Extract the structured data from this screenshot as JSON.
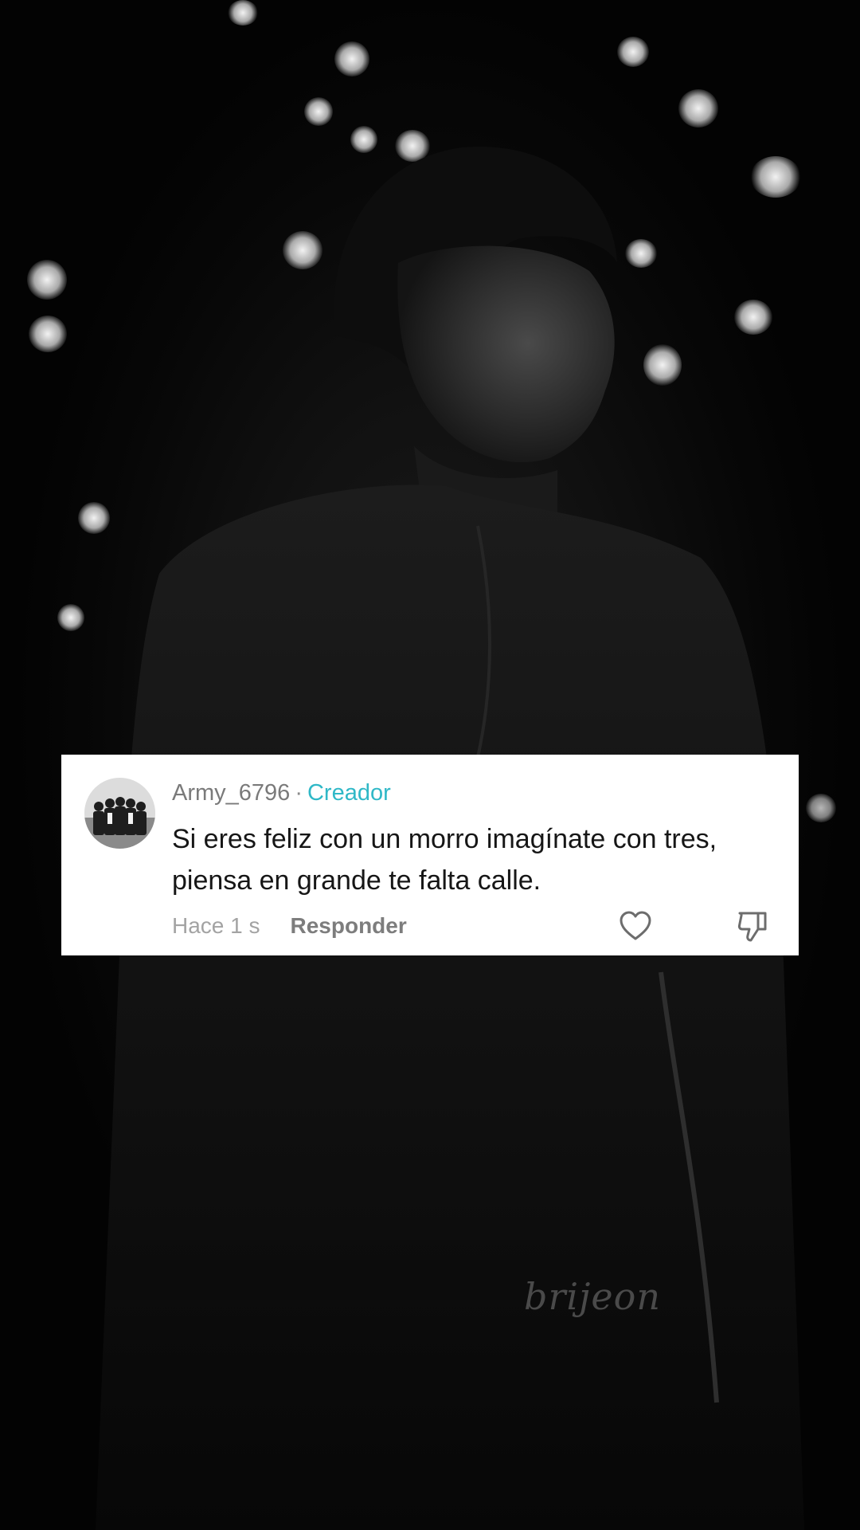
{
  "background": {
    "watermark": "brijeon"
  },
  "comment": {
    "username": "Army_6796",
    "separator": "·",
    "role_label": "Creador",
    "role_color": "#2fb8c7",
    "text": "Si eres feliz con un morro imagínate con tres, piensa en grande te falta calle.",
    "timestamp": "Hace 1 s",
    "reply_label": "Responder",
    "icons": {
      "avatar": "group-photo-avatar",
      "like": "heart-icon",
      "dislike": "thumbs-down-icon"
    }
  }
}
